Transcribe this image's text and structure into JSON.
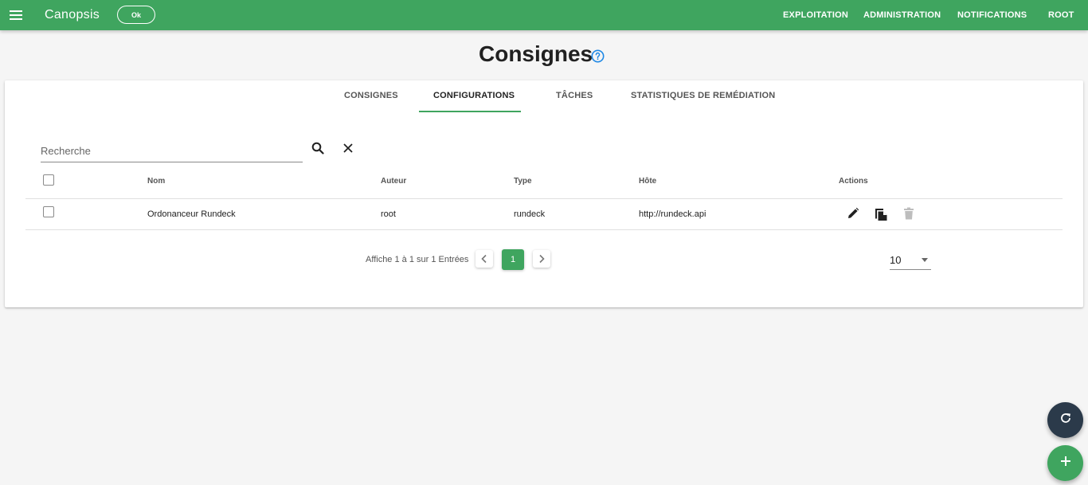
{
  "header": {
    "app_name": "Canopsis",
    "status_chip": "Ok",
    "nav": [
      "EXPLOITATION",
      "ADMINISTRATION",
      "NOTIFICATIONS",
      "ROOT"
    ]
  },
  "page": {
    "title": "Consignes"
  },
  "tabs": [
    {
      "label": "CONSIGNES",
      "active": false
    },
    {
      "label": "CONFIGURATIONS",
      "active": true
    },
    {
      "label": "TÂCHES",
      "active": false
    },
    {
      "label": "STATISTIQUES DE REMÉDIATION",
      "active": false
    }
  ],
  "search": {
    "placeholder": "Recherche",
    "value": ""
  },
  "table": {
    "columns": [
      "Nom",
      "Auteur",
      "Type",
      "Hôte",
      "Actions"
    ],
    "rows": [
      {
        "name": "Ordonanceur Rundeck",
        "author": "root",
        "type": "rundeck",
        "host": "http://rundeck.api"
      }
    ]
  },
  "pagination": {
    "info": "Affiche 1 à 1 sur 1 Entrées",
    "current_page": "1",
    "per_page": "10"
  },
  "colors": {
    "accent": "#3fa55f",
    "fab_refresh": "#2b3a4a",
    "help": "#1e88e5"
  },
  "icons": {
    "menu": "menu-icon",
    "help": "help-circle-icon",
    "search": "search-icon",
    "clear": "close-icon",
    "edit": "pencil-icon",
    "duplicate": "copy-icon",
    "delete": "trash-icon",
    "prev": "chevron-left-icon",
    "next": "chevron-right-icon",
    "refresh": "refresh-icon",
    "add": "plus-icon"
  }
}
